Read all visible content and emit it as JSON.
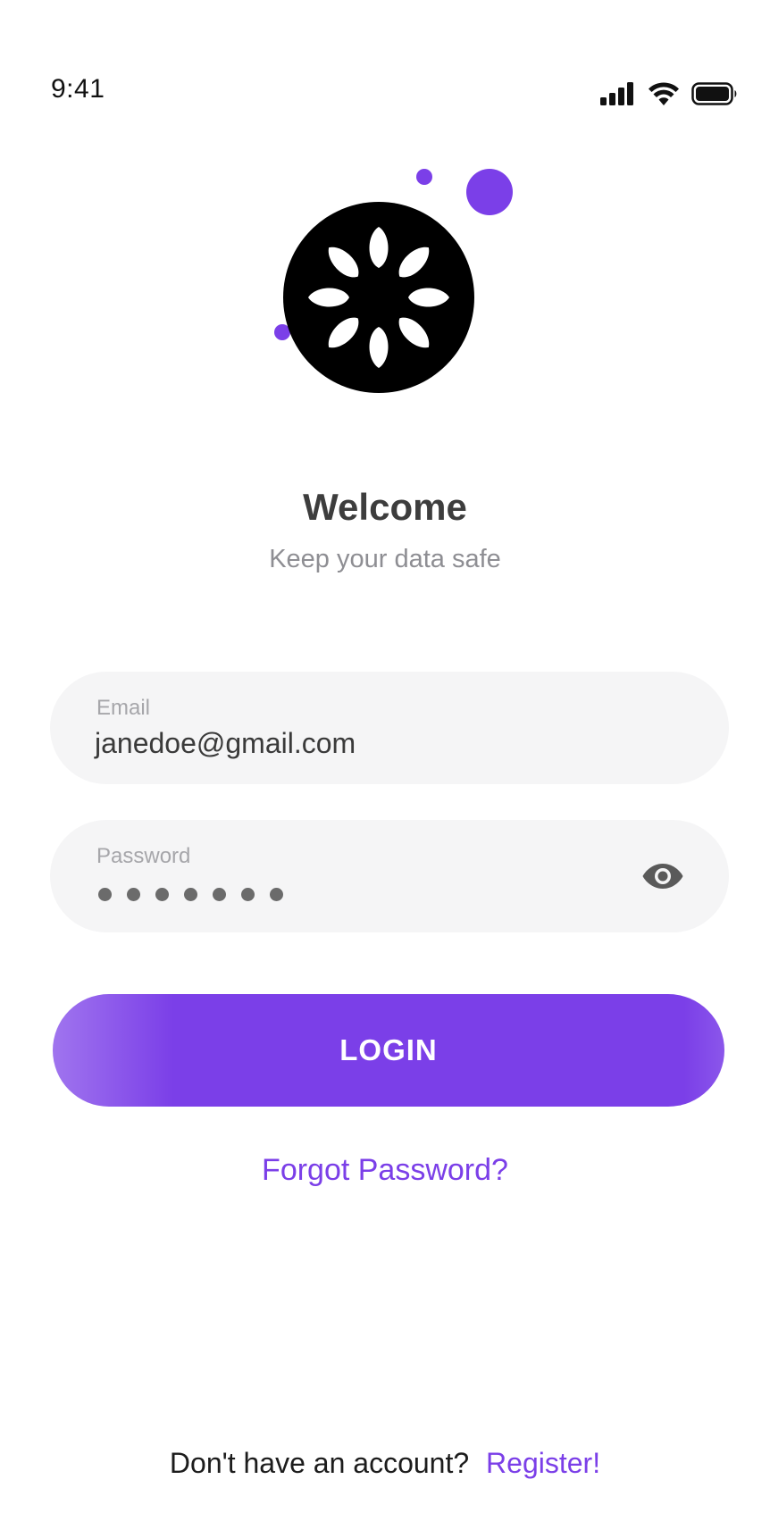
{
  "status_bar": {
    "time": "9:41"
  },
  "icons": {
    "signal": "cellular-signal-icon",
    "wifi": "wifi-icon",
    "battery": "battery-icon",
    "logo": "app-logo",
    "password_toggle": "eye-icon"
  },
  "welcome": {
    "title": "Welcome",
    "subtitle": "Keep your data safe"
  },
  "form": {
    "email": {
      "label": "Email",
      "value": "janedoe@gmail.com"
    },
    "password": {
      "label": "Password",
      "masked_length": 7
    },
    "login_label": "LOGIN",
    "forgot_label": "Forgot Password?"
  },
  "footer": {
    "prompt": "Don't have an account?",
    "register_label": "Register!"
  },
  "colors": {
    "accent": "#7b3fe8",
    "field_background": "#f5f5f6",
    "title": "#3d3d3d",
    "subtitle": "#8e8e93",
    "logo": "#000000"
  }
}
